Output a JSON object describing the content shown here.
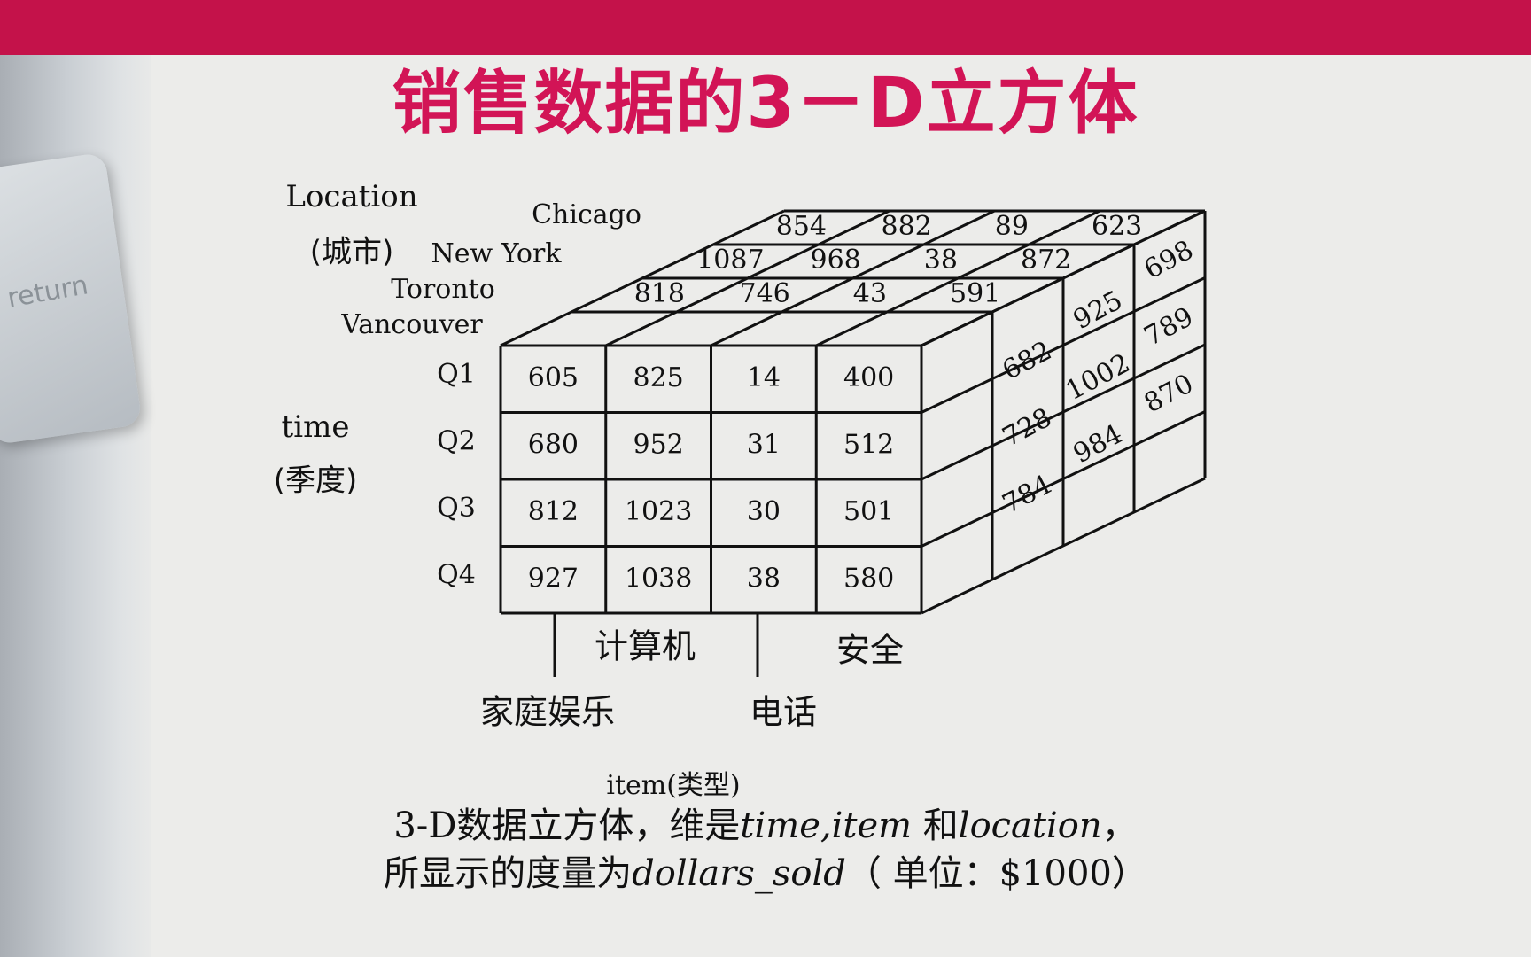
{
  "title": "销售数据的3－D立方体",
  "axes": {
    "location_label": "Location",
    "location_cn": "(城市)",
    "time_label": "time",
    "time_cn": "(季度)",
    "item_label": "item(类型)"
  },
  "cities": [
    "Chicago",
    "New York",
    "Toronto",
    "Vancouver"
  ],
  "quarters": [
    "Q1",
    "Q2",
    "Q3",
    "Q4"
  ],
  "items": [
    "家庭娱乐",
    "计算机",
    "电话",
    "安全"
  ],
  "front_values": [
    [
      "605",
      "825",
      "14",
      "400"
    ],
    [
      "680",
      "952",
      "31",
      "512"
    ],
    [
      "812",
      "1023",
      "30",
      "501"
    ],
    [
      "927",
      "1038",
      "38",
      "580"
    ]
  ],
  "top_values": {
    "Chicago": [
      "854",
      "882",
      "89",
      "623"
    ],
    "New York": [
      "1087",
      "968",
      "38",
      "872"
    ],
    "Toronto": [
      "818",
      "746",
      "43",
      "591"
    ]
  },
  "side_values": {
    "Toronto": [
      "682",
      "728",
      "784"
    ],
    "New York": [
      "925",
      "1002",
      "984"
    ],
    "Chicago": [
      "698",
      "789",
      "870"
    ]
  },
  "caption": {
    "line1_a": "3-D数据立方体，维是",
    "line1_b": "time,item",
    "line1_c": " 和",
    "line1_d": "location",
    "line1_e": "，",
    "line2_a": "所显示的度量为",
    "line2_b": "dollars_sold",
    "line2_c": "（ 单位：$1000）"
  },
  "side_label": "return",
  "colors": {
    "bar": "#c4124a",
    "title": "#d21456"
  }
}
